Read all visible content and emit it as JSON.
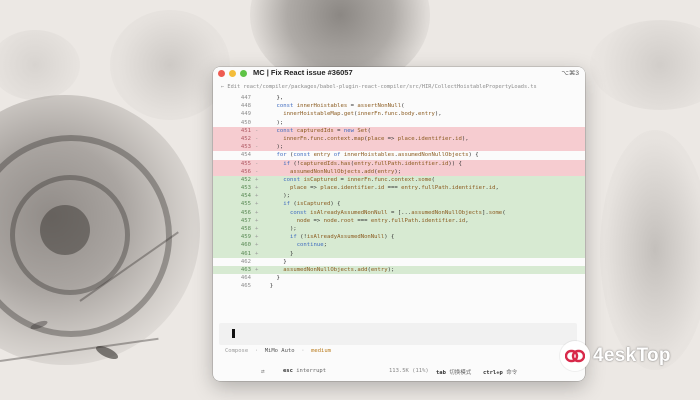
{
  "window": {
    "title": "MC | Fix React issue #36057",
    "shortcut": "⌥⌘3",
    "path": "← Edit react/compiler/packages/babel-plugin-react-compiler/src/HIR/CollectHoistablePropertyLoads.ts"
  },
  "diff": {
    "lines": [
      {
        "num": "447",
        "mark": "",
        "type": "ctx",
        "text": "    },"
      },
      {
        "num": "448",
        "mark": "",
        "type": "ctx",
        "text": "    const innerHoistables = assertNonNull("
      },
      {
        "num": "449",
        "mark": "",
        "type": "ctx",
        "text": "      innerHoistableMap.get(innerFn.func.body.entry),"
      },
      {
        "num": "450",
        "mark": "",
        "type": "ctx",
        "text": "    );"
      },
      {
        "num": "451",
        "mark": "-",
        "type": "del",
        "text": "    const capturedIds = new Set("
      },
      {
        "num": "452",
        "mark": "-",
        "type": "del",
        "text": "      innerFn.func.context.map(place => place.identifier.id),"
      },
      {
        "num": "453",
        "mark": "-",
        "type": "del",
        "text": "    );"
      },
      {
        "num": "454",
        "mark": "",
        "type": "ctx",
        "text": "    for (const entry of innerHoistables.assumedNonNullObjects) {"
      },
      {
        "num": "455",
        "mark": "-",
        "type": "del",
        "text": "      if (!capturedIds.has(entry.fullPath.identifier.id)) {"
      },
      {
        "num": "456",
        "mark": "-",
        "type": "del",
        "text": "        assumedNonNullObjects.add(entry);"
      },
      {
        "num": "452",
        "mark": "+",
        "type": "add",
        "text": "      const isCaptured = innerFn.func.context.some("
      },
      {
        "num": "453",
        "mark": "+",
        "type": "add",
        "text": "        place => place.identifier.id === entry.fullPath.identifier.id,"
      },
      {
        "num": "454",
        "mark": "+",
        "type": "add",
        "text": "      );"
      },
      {
        "num": "455",
        "mark": "+",
        "type": "add",
        "text": "      if (isCaptured) {"
      },
      {
        "num": "456",
        "mark": "+",
        "type": "add",
        "text": "        const isAlreadyAssumedNonNull = [...assumedNonNullObjects].some("
      },
      {
        "num": "457",
        "mark": "+",
        "type": "add",
        "text": "          node => node.root === entry.fullPath.identifier.id,"
      },
      {
        "num": "458",
        "mark": "+",
        "type": "add",
        "text": "        );"
      },
      {
        "num": "459",
        "mark": "+",
        "type": "add",
        "text": "        if (!isAlreadyAssumedNonNull) {"
      },
      {
        "num": "460",
        "mark": "+",
        "type": "add",
        "text": "          continue;"
      },
      {
        "num": "461",
        "mark": "+",
        "type": "add",
        "text": "        }"
      },
      {
        "num": "462",
        "mark": "",
        "type": "ctx",
        "text": "      }"
      },
      {
        "num": "463",
        "mark": "+",
        "type": "add",
        "text": "      assumedNonNullObjects.add(entry);"
      },
      {
        "num": "464",
        "mark": "",
        "type": "ctx",
        "text": "    }"
      },
      {
        "num": "465",
        "mark": "",
        "type": "ctx",
        "text": "  }"
      }
    ]
  },
  "status": {
    "mode": "Compose",
    "separator": "·",
    "model": "MiMo Auto",
    "effort": "medium"
  },
  "footer": {
    "icon": "⇄",
    "esc_key": "esc",
    "esc_label": "interrupt",
    "tokens": "113.5K (11%)",
    "tab_key": "tab",
    "tab_label": "切换模式",
    "ctrl_key": "ctrl+p",
    "ctrl_label": "命令"
  },
  "watermark": {
    "text": "4eskTop",
    "logo_color": "#d8294a"
  }
}
